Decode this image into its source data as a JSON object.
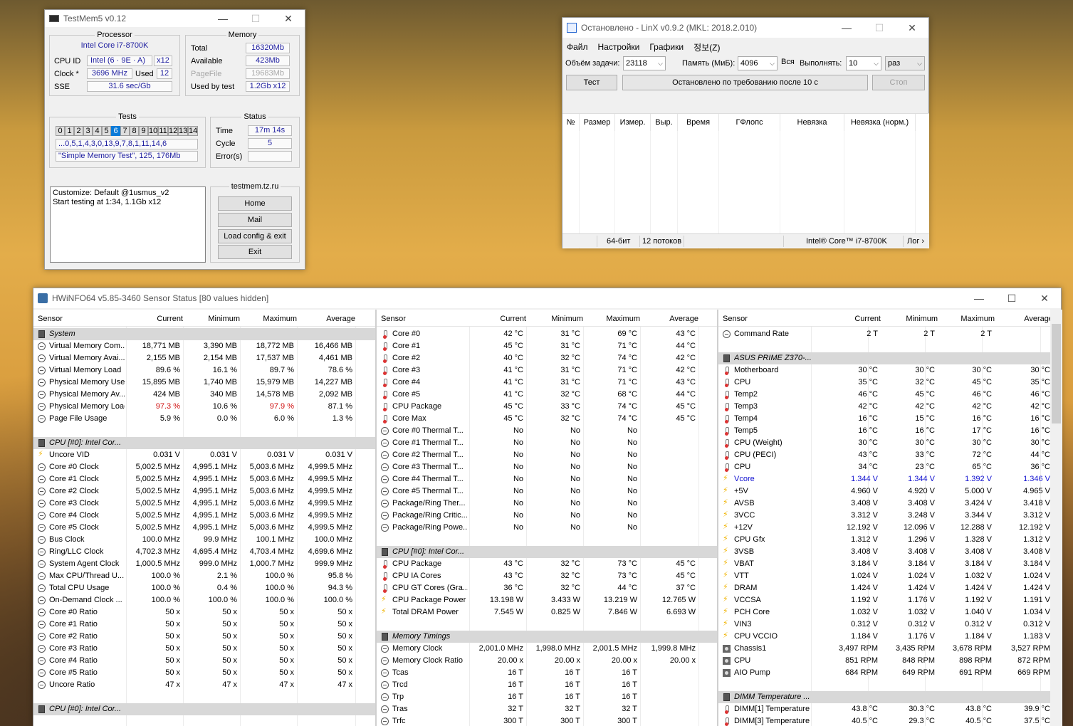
{
  "testmem": {
    "title": "TestMem5 v0.12",
    "processor": {
      "group": "Processor",
      "name": "Intel Core i7-8700K",
      "cpuid_label": "CPU ID",
      "cpuid_value": "Intel  (6 · 9E · A)",
      "cpuid_threads": "x12",
      "clock_label": "Clock *",
      "clock_value": "3696 MHz",
      "used_label": "Used",
      "used_value": "12",
      "sse_label": "SSE",
      "sse_value": "31.6 sec/Gb"
    },
    "memory": {
      "group": "Memory",
      "total_label": "Total",
      "total_value": "16320Mb",
      "available_label": "Available",
      "available_value": "423Mb",
      "pagefile_label": "PageFile",
      "pagefile_value": "19683Mb",
      "usedbytest_label": "Used by test",
      "usedbytest_value": "1.2Gb x12"
    },
    "tests": {
      "group": "Tests",
      "cells": [
        "0",
        "1",
        "2",
        "3",
        "4",
        "5",
        "6",
        "7",
        "8",
        "9",
        "10",
        "11",
        "12",
        "13",
        "14"
      ],
      "active_index": 6,
      "order": "...0,5,1,4,3,0,13,9,7,8,1,11,14,6",
      "current": "\"Simple Memory Test\", 125, 176Mb"
    },
    "status": {
      "group": "Status",
      "time_label": "Time",
      "time_value": "17m 14s",
      "cycle_label": "Cycle",
      "cycle_value": "5",
      "errors_label": "Error(s)",
      "errors_value": ""
    },
    "log": [
      "Customize: Default @1usmus_v2",
      "Start testing at 1:34, 1.1Gb x12"
    ],
    "site": "testmem.tz.ru",
    "buttons": {
      "home": "Home",
      "mail": "Mail",
      "load": "Load config & exit",
      "exit": "Exit"
    }
  },
  "linx": {
    "title": "Остановлено - LinX v0.9.2 (MKL: 2018.2.010)",
    "menu": [
      "Файл",
      "Настройки",
      "Графики",
      "정보(Z)"
    ],
    "task_label": "Объём задачи:",
    "task_value": "23118",
    "mem_label": "Память (МиБ):",
    "mem_value": "4096",
    "all_label": "Вся",
    "run_label": "Выполнять:",
    "run_value": "10",
    "run_unit": "раз",
    "test_button": "Тест",
    "status_message": "Остановлено по требованию после 10 с",
    "stop_button": "Стоп",
    "columns": [
      "№",
      "Размер",
      "Измер.",
      "Выр.",
      "Время",
      "ГФлопс",
      "Невязка",
      "Невязка (норм.)"
    ],
    "statusbar": {
      "bits": "64-бит",
      "threads": "12 потоков",
      "cpu": "Intel® Core™ i7-8700K",
      "log": "Лог ›"
    }
  },
  "hwinfo": {
    "title": "HWiNFO64 v5.85-3460 Sensor Status [80 values hidden]",
    "columns": [
      "Sensor",
      "Current",
      "Minimum",
      "Maximum",
      "Average"
    ],
    "pane1": [
      {
        "type": "group",
        "name": "System"
      },
      {
        "icon": "circ",
        "name": "Virtual Memory Com...",
        "c": "18,771 MB",
        "min": "3,390 MB",
        "max": "18,772 MB",
        "avg": "16,466 MB"
      },
      {
        "icon": "circ",
        "name": "Virtual Memory Avai...",
        "c": "2,155 MB",
        "min": "2,154 MB",
        "max": "17,537 MB",
        "avg": "4,461 MB"
      },
      {
        "icon": "circ",
        "name": "Virtual Memory Load",
        "c": "89.6 %",
        "min": "16.1 %",
        "max": "89.7 %",
        "avg": "78.6 %"
      },
      {
        "icon": "circ",
        "name": "Physical Memory Used",
        "c": "15,895 MB",
        "min": "1,740 MB",
        "max": "15,979 MB",
        "avg": "14,227 MB"
      },
      {
        "icon": "circ",
        "name": "Physical Memory Av...",
        "c": "424 MB",
        "min": "340 MB",
        "max": "14,578 MB",
        "avg": "2,092 MB"
      },
      {
        "icon": "circ",
        "name": "Physical Memory Load",
        "c": "97.3 %",
        "min": "10.6 %",
        "max": "97.9 %",
        "avg": "87.1 %",
        "red": true
      },
      {
        "icon": "circ",
        "name": "Page File Usage",
        "c": "5.9 %",
        "min": "0.0 %",
        "max": "6.0 %",
        "avg": "1.3 %"
      },
      {
        "type": "blank"
      },
      {
        "type": "group",
        "name": "CPU [#0]: Intel Cor..."
      },
      {
        "icon": "bolt",
        "name": "Uncore VID",
        "c": "0.031 V",
        "min": "0.031 V",
        "max": "0.031 V",
        "avg": "0.031 V"
      },
      {
        "icon": "circ",
        "name": "Core #0 Clock",
        "c": "5,002.5 MHz",
        "min": "4,995.1 MHz",
        "max": "5,003.6 MHz",
        "avg": "4,999.5 MHz"
      },
      {
        "icon": "circ",
        "name": "Core #1 Clock",
        "c": "5,002.5 MHz",
        "min": "4,995.1 MHz",
        "max": "5,003.6 MHz",
        "avg": "4,999.5 MHz"
      },
      {
        "icon": "circ",
        "name": "Core #2 Clock",
        "c": "5,002.5 MHz",
        "min": "4,995.1 MHz",
        "max": "5,003.6 MHz",
        "avg": "4,999.5 MHz"
      },
      {
        "icon": "circ",
        "name": "Core #3 Clock",
        "c": "5,002.5 MHz",
        "min": "4,995.1 MHz",
        "max": "5,003.6 MHz",
        "avg": "4,999.5 MHz"
      },
      {
        "icon": "circ",
        "name": "Core #4 Clock",
        "c": "5,002.5 MHz",
        "min": "4,995.1 MHz",
        "max": "5,003.6 MHz",
        "avg": "4,999.5 MHz"
      },
      {
        "icon": "circ",
        "name": "Core #5 Clock",
        "c": "5,002.5 MHz",
        "min": "4,995.1 MHz",
        "max": "5,003.6 MHz",
        "avg": "4,999.5 MHz"
      },
      {
        "icon": "circ",
        "name": "Bus Clock",
        "c": "100.0 MHz",
        "min": "99.9 MHz",
        "max": "100.1 MHz",
        "avg": "100.0 MHz"
      },
      {
        "icon": "circ",
        "name": "Ring/LLC Clock",
        "c": "4,702.3 MHz",
        "min": "4,695.4 MHz",
        "max": "4,703.4 MHz",
        "avg": "4,699.6 MHz"
      },
      {
        "icon": "circ",
        "name": "System Agent Clock",
        "c": "1,000.5 MHz",
        "min": "999.0 MHz",
        "max": "1,000.7 MHz",
        "avg": "999.9 MHz"
      },
      {
        "icon": "circ",
        "name": "Max CPU/Thread U...",
        "c": "100.0 %",
        "min": "2.1 %",
        "max": "100.0 %",
        "avg": "95.8 %"
      },
      {
        "icon": "circ",
        "name": "Total CPU Usage",
        "c": "100.0 %",
        "min": "0.4 %",
        "max": "100.0 %",
        "avg": "94.3 %"
      },
      {
        "icon": "circ",
        "name": "On-Demand Clock ...",
        "c": "100.0 %",
        "min": "100.0 %",
        "max": "100.0 %",
        "avg": "100.0 %"
      },
      {
        "icon": "circ",
        "name": "Core #0 Ratio",
        "c": "50 x",
        "min": "50 x",
        "max": "50 x",
        "avg": "50 x"
      },
      {
        "icon": "circ",
        "name": "Core #1 Ratio",
        "c": "50 x",
        "min": "50 x",
        "max": "50 x",
        "avg": "50 x"
      },
      {
        "icon": "circ",
        "name": "Core #2 Ratio",
        "c": "50 x",
        "min": "50 x",
        "max": "50 x",
        "avg": "50 x"
      },
      {
        "icon": "circ",
        "name": "Core #3 Ratio",
        "c": "50 x",
        "min": "50 x",
        "max": "50 x",
        "avg": "50 x"
      },
      {
        "icon": "circ",
        "name": "Core #4 Ratio",
        "c": "50 x",
        "min": "50 x",
        "max": "50 x",
        "avg": "50 x"
      },
      {
        "icon": "circ",
        "name": "Core #5 Ratio",
        "c": "50 x",
        "min": "50 x",
        "max": "50 x",
        "avg": "50 x"
      },
      {
        "icon": "circ",
        "name": "Uncore Ratio",
        "c": "47 x",
        "min": "47 x",
        "max": "47 x",
        "avg": "47 x"
      },
      {
        "type": "blank"
      },
      {
        "type": "group",
        "name": "CPU [#0]: Intel Cor..."
      }
    ],
    "pane2": [
      {
        "icon": "therm",
        "name": "Core #0",
        "c": "42 °C",
        "min": "31 °C",
        "max": "69 °C",
        "avg": "43 °C"
      },
      {
        "icon": "therm",
        "name": "Core #1",
        "c": "45 °C",
        "min": "31 °C",
        "max": "71 °C",
        "avg": "44 °C"
      },
      {
        "icon": "therm",
        "name": "Core #2",
        "c": "40 °C",
        "min": "32 °C",
        "max": "74 °C",
        "avg": "42 °C"
      },
      {
        "icon": "therm",
        "name": "Core #3",
        "c": "41 °C",
        "min": "31 °C",
        "max": "71 °C",
        "avg": "42 °C"
      },
      {
        "icon": "therm",
        "name": "Core #4",
        "c": "41 °C",
        "min": "31 °C",
        "max": "71 °C",
        "avg": "43 °C"
      },
      {
        "icon": "therm",
        "name": "Core #5",
        "c": "41 °C",
        "min": "32 °C",
        "max": "68 °C",
        "avg": "44 °C"
      },
      {
        "icon": "therm",
        "name": "CPU Package",
        "c": "45 °C",
        "min": "33 °C",
        "max": "74 °C",
        "avg": "45 °C"
      },
      {
        "icon": "therm",
        "name": "Core Max",
        "c": "45 °C",
        "min": "32 °C",
        "max": "74 °C",
        "avg": "45 °C"
      },
      {
        "icon": "circ",
        "name": "Core #0 Thermal T...",
        "c": "No",
        "min": "No",
        "max": "No",
        "avg": ""
      },
      {
        "icon": "circ",
        "name": "Core #1 Thermal T...",
        "c": "No",
        "min": "No",
        "max": "No",
        "avg": ""
      },
      {
        "icon": "circ",
        "name": "Core #2 Thermal T...",
        "c": "No",
        "min": "No",
        "max": "No",
        "avg": ""
      },
      {
        "icon": "circ",
        "name": "Core #3 Thermal T...",
        "c": "No",
        "min": "No",
        "max": "No",
        "avg": ""
      },
      {
        "icon": "circ",
        "name": "Core #4 Thermal T...",
        "c": "No",
        "min": "No",
        "max": "No",
        "avg": ""
      },
      {
        "icon": "circ",
        "name": "Core #5 Thermal T...",
        "c": "No",
        "min": "No",
        "max": "No",
        "avg": ""
      },
      {
        "icon": "circ",
        "name": "Package/Ring Ther...",
        "c": "No",
        "min": "No",
        "max": "No",
        "avg": ""
      },
      {
        "icon": "circ",
        "name": "Package/Ring Critic...",
        "c": "No",
        "min": "No",
        "max": "No",
        "avg": ""
      },
      {
        "icon": "circ",
        "name": "Package/Ring Powe...",
        "c": "No",
        "min": "No",
        "max": "No",
        "avg": ""
      },
      {
        "type": "blank"
      },
      {
        "type": "group",
        "name": "CPU [#0]: Intel Cor..."
      },
      {
        "icon": "therm",
        "name": "CPU Package",
        "c": "43 °C",
        "min": "32 °C",
        "max": "73 °C",
        "avg": "45 °C"
      },
      {
        "icon": "therm",
        "name": "CPU IA Cores",
        "c": "43 °C",
        "min": "32 °C",
        "max": "73 °C",
        "avg": "45 °C"
      },
      {
        "icon": "therm",
        "name": "CPU GT Cores (Gra...",
        "c": "36 °C",
        "min": "32 °C",
        "max": "44 °C",
        "avg": "37 °C"
      },
      {
        "icon": "bolt",
        "name": "CPU Package Power",
        "c": "13.198 W",
        "min": "3.433 W",
        "max": "13.219 W",
        "avg": "12.765 W"
      },
      {
        "icon": "bolt",
        "name": "Total DRAM Power",
        "c": "7.545 W",
        "min": "0.825 W",
        "max": "7.846 W",
        "avg": "6.693 W"
      },
      {
        "type": "blank"
      },
      {
        "type": "group",
        "name": "Memory Timings"
      },
      {
        "icon": "circ",
        "name": "Memory Clock",
        "c": "2,001.0 MHz",
        "min": "1,998.0 MHz",
        "max": "2,001.5 MHz",
        "avg": "1,999.8 MHz"
      },
      {
        "icon": "circ",
        "name": "Memory Clock Ratio",
        "c": "20.00 x",
        "min": "20.00 x",
        "max": "20.00 x",
        "avg": "20.00 x"
      },
      {
        "icon": "circ",
        "name": "Tcas",
        "c": "16 T",
        "min": "16 T",
        "max": "16 T",
        "avg": ""
      },
      {
        "icon": "circ",
        "name": "Trcd",
        "c": "16 T",
        "min": "16 T",
        "max": "16 T",
        "avg": ""
      },
      {
        "icon": "circ",
        "name": "Trp",
        "c": "16 T",
        "min": "16 T",
        "max": "16 T",
        "avg": ""
      },
      {
        "icon": "circ",
        "name": "Tras",
        "c": "32 T",
        "min": "32 T",
        "max": "32 T",
        "avg": ""
      },
      {
        "icon": "circ",
        "name": "Trfc",
        "c": "300 T",
        "min": "300 T",
        "max": "300 T",
        "avg": ""
      }
    ],
    "pane3": [
      {
        "icon": "circ",
        "name": "Command Rate",
        "c": "2 T",
        "min": "2 T",
        "max": "2 T",
        "avg": ""
      },
      {
        "type": "blank"
      },
      {
        "type": "group",
        "name": "ASUS PRIME Z370-..."
      },
      {
        "icon": "therm",
        "name": "Motherboard",
        "c": "30 °C",
        "min": "30 °C",
        "max": "30 °C",
        "avg": "30 °C"
      },
      {
        "icon": "therm",
        "name": "CPU",
        "c": "35 °C",
        "min": "32 °C",
        "max": "45 °C",
        "avg": "35 °C"
      },
      {
        "icon": "therm",
        "name": "Temp2",
        "c": "46 °C",
        "min": "45 °C",
        "max": "46 °C",
        "avg": "46 °C"
      },
      {
        "icon": "therm",
        "name": "Temp3",
        "c": "42 °C",
        "min": "42 °C",
        "max": "42 °C",
        "avg": "42 °C"
      },
      {
        "icon": "therm",
        "name": "Temp4",
        "c": "16 °C",
        "min": "15 °C",
        "max": "16 °C",
        "avg": "16 °C"
      },
      {
        "icon": "therm",
        "name": "Temp5",
        "c": "16 °C",
        "min": "16 °C",
        "max": "17 °C",
        "avg": "16 °C"
      },
      {
        "icon": "therm",
        "name": "CPU (Weight)",
        "c": "30 °C",
        "min": "30 °C",
        "max": "30 °C",
        "avg": "30 °C"
      },
      {
        "icon": "therm",
        "name": "CPU (PECI)",
        "c": "43 °C",
        "min": "33 °C",
        "max": "72 °C",
        "avg": "44 °C"
      },
      {
        "icon": "therm",
        "name": "CPU",
        "c": "34 °C",
        "min": "23 °C",
        "max": "65 °C",
        "avg": "36 °C"
      },
      {
        "icon": "bolt",
        "name": "Vcore",
        "c": "1.344 V",
        "min": "1.344 V",
        "max": "1.392 V",
        "avg": "1.346 V",
        "blue": true
      },
      {
        "icon": "bolt",
        "name": "+5V",
        "c": "4.960 V",
        "min": "4.920 V",
        "max": "5.000 V",
        "avg": "4.965 V"
      },
      {
        "icon": "bolt",
        "name": "AVSB",
        "c": "3.408 V",
        "min": "3.408 V",
        "max": "3.424 V",
        "avg": "3.418 V"
      },
      {
        "icon": "bolt",
        "name": "3VCC",
        "c": "3.312 V",
        "min": "3.248 V",
        "max": "3.344 V",
        "avg": "3.312 V"
      },
      {
        "icon": "bolt",
        "name": "+12V",
        "c": "12.192 V",
        "min": "12.096 V",
        "max": "12.288 V",
        "avg": "12.192 V"
      },
      {
        "icon": "bolt",
        "name": "CPU Gfx",
        "c": "1.312 V",
        "min": "1.296 V",
        "max": "1.328 V",
        "avg": "1.312 V"
      },
      {
        "icon": "bolt",
        "name": "3VSB",
        "c": "3.408 V",
        "min": "3.408 V",
        "max": "3.408 V",
        "avg": "3.408 V"
      },
      {
        "icon": "bolt",
        "name": "VBAT",
        "c": "3.184 V",
        "min": "3.184 V",
        "max": "3.184 V",
        "avg": "3.184 V"
      },
      {
        "icon": "bolt",
        "name": "VTT",
        "c": "1.024 V",
        "min": "1.024 V",
        "max": "1.032 V",
        "avg": "1.024 V"
      },
      {
        "icon": "bolt",
        "name": "DRAM",
        "c": "1.424 V",
        "min": "1.424 V",
        "max": "1.424 V",
        "avg": "1.424 V"
      },
      {
        "icon": "bolt",
        "name": "VCCSA",
        "c": "1.192 V",
        "min": "1.176 V",
        "max": "1.192 V",
        "avg": "1.191 V"
      },
      {
        "icon": "bolt",
        "name": "PCH Core",
        "c": "1.032 V",
        "min": "1.032 V",
        "max": "1.040 V",
        "avg": "1.034 V"
      },
      {
        "icon": "bolt",
        "name": "VIN3",
        "c": "0.312 V",
        "min": "0.312 V",
        "max": "0.312 V",
        "avg": "0.312 V"
      },
      {
        "icon": "bolt",
        "name": "CPU VCCIO",
        "c": "1.184 V",
        "min": "1.176 V",
        "max": "1.184 V",
        "avg": "1.183 V"
      },
      {
        "icon": "fan",
        "name": "Chassis1",
        "c": "3,497 RPM",
        "min": "3,435 RPM",
        "max": "3,678 RPM",
        "avg": "3,527 RPM"
      },
      {
        "icon": "fan",
        "name": "CPU",
        "c": "851 RPM",
        "min": "848 RPM",
        "max": "898 RPM",
        "avg": "872 RPM"
      },
      {
        "icon": "fan",
        "name": "AIO Pump",
        "c": "684 RPM",
        "min": "649 RPM",
        "max": "691 RPM",
        "avg": "669 RPM"
      },
      {
        "type": "blank"
      },
      {
        "type": "group",
        "name": "DIMM Temperature ..."
      },
      {
        "icon": "therm",
        "name": "DIMM[1] Temperature",
        "c": "43.8 °C",
        "min": "30.3 °C",
        "max": "43.8 °C",
        "avg": "39.9 °C"
      },
      {
        "icon": "therm",
        "name": "DIMM[3] Temperature",
        "c": "40.5 °C",
        "min": "29.3 °C",
        "max": "40.5 °C",
        "avg": "37.5 °C"
      }
    ]
  }
}
